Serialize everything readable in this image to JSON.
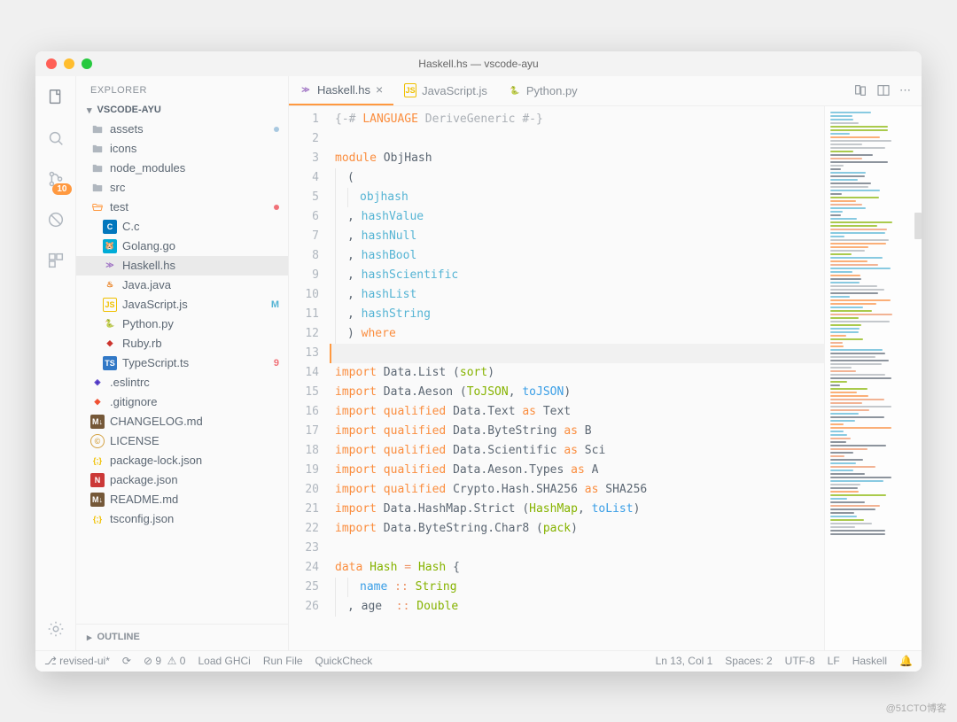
{
  "window": {
    "title": "Haskell.hs — vscode-ayu"
  },
  "sidebar": {
    "title": "EXPLORER",
    "folder": "VSCODE-AYU",
    "outline": "OUTLINE"
  },
  "activitybar": {
    "scm_badge": "10"
  },
  "tree": [
    {
      "depth": 0,
      "type": "folder",
      "label": "assets",
      "badge": "bluedot"
    },
    {
      "depth": 0,
      "type": "folder",
      "label": "icons"
    },
    {
      "depth": 0,
      "type": "folder",
      "label": "node_modules"
    },
    {
      "depth": 0,
      "type": "folder",
      "label": "src"
    },
    {
      "depth": 0,
      "type": "folder-open",
      "label": "test",
      "badge": "reddot"
    },
    {
      "depth": 1,
      "type": "c",
      "label": "C.c"
    },
    {
      "depth": 1,
      "type": "go",
      "label": "Golang.go"
    },
    {
      "depth": 1,
      "type": "hs",
      "label": "Haskell.hs",
      "selected": true
    },
    {
      "depth": 1,
      "type": "java",
      "label": "Java.java"
    },
    {
      "depth": 1,
      "type": "js",
      "label": "JavaScript.js",
      "badge": "M"
    },
    {
      "depth": 1,
      "type": "py",
      "label": "Python.py"
    },
    {
      "depth": 1,
      "type": "rb",
      "label": "Ruby.rb"
    },
    {
      "depth": 1,
      "type": "ts",
      "label": "TypeScript.ts",
      "badge": "9"
    },
    {
      "depth": 0,
      "type": "eslint",
      "label": ".eslintrc"
    },
    {
      "depth": 0,
      "type": "git",
      "label": ".gitignore"
    },
    {
      "depth": 0,
      "type": "md",
      "label": "CHANGELOG.md"
    },
    {
      "depth": 0,
      "type": "lic",
      "label": "LICENSE"
    },
    {
      "depth": 0,
      "type": "json",
      "label": "package-lock.json"
    },
    {
      "depth": 0,
      "type": "npm",
      "label": "package.json"
    },
    {
      "depth": 0,
      "type": "md",
      "label": "README.md"
    },
    {
      "depth": 0,
      "type": "json",
      "label": "tsconfig.json"
    }
  ],
  "tabs": [
    {
      "icon": "hs",
      "label": "Haskell.hs",
      "active": true,
      "dirty": true
    },
    {
      "icon": "js",
      "label": "JavaScript.js"
    },
    {
      "icon": "py",
      "label": "Python.py"
    }
  ],
  "code": [
    {
      "n": 1,
      "tokens": [
        [
          "comment",
          "{-# "
        ],
        [
          "kw",
          "LANGUAGE"
        ],
        [
          "comment",
          " DeriveGeneric #-}"
        ]
      ]
    },
    {
      "n": 2,
      "tokens": []
    },
    {
      "n": 3,
      "tokens": [
        [
          "kw",
          "module"
        ],
        [
          "punc",
          " ObjHash"
        ]
      ]
    },
    {
      "n": 4,
      "ind": 1,
      "tokens": [
        [
          "punc",
          "("
        ]
      ]
    },
    {
      "n": 5,
      "ind": 2,
      "tokens": [
        [
          "id",
          "objhash"
        ]
      ]
    },
    {
      "n": 6,
      "ind": 1,
      "tokens": [
        [
          "punc",
          ", "
        ],
        [
          "id",
          "hashValue"
        ]
      ]
    },
    {
      "n": 7,
      "ind": 1,
      "tokens": [
        [
          "punc",
          ", "
        ],
        [
          "id",
          "hashNull"
        ]
      ]
    },
    {
      "n": 8,
      "ind": 1,
      "tokens": [
        [
          "punc",
          ", "
        ],
        [
          "id",
          "hashBool"
        ]
      ]
    },
    {
      "n": 9,
      "ind": 1,
      "tokens": [
        [
          "punc",
          ", "
        ],
        [
          "id",
          "hashScientific"
        ]
      ]
    },
    {
      "n": 10,
      "ind": 1,
      "tokens": [
        [
          "punc",
          ", "
        ],
        [
          "id",
          "hashList"
        ]
      ]
    },
    {
      "n": 11,
      "ind": 1,
      "tokens": [
        [
          "punc",
          ", "
        ],
        [
          "id",
          "hashString"
        ]
      ]
    },
    {
      "n": 12,
      "ind": 1,
      "tokens": [
        [
          "punc",
          ") "
        ],
        [
          "kw",
          "where"
        ]
      ]
    },
    {
      "n": 13,
      "cur": true,
      "tokens": []
    },
    {
      "n": 14,
      "tokens": [
        [
          "kw",
          "import"
        ],
        [
          "punc",
          " Data.List ("
        ],
        [
          "type",
          "sort"
        ],
        [
          "punc",
          ")"
        ]
      ]
    },
    {
      "n": 15,
      "tokens": [
        [
          "kw",
          "import"
        ],
        [
          "punc",
          " Data.Aeson ("
        ],
        [
          "type",
          "ToJSON"
        ],
        [
          "punc",
          ", "
        ],
        [
          "id2",
          "toJSON"
        ],
        [
          "punc",
          ")"
        ]
      ]
    },
    {
      "n": 16,
      "tokens": [
        [
          "kw",
          "import"
        ],
        [
          "punc",
          " "
        ],
        [
          "kw",
          "qualified"
        ],
        [
          "punc",
          " Data.Text "
        ],
        [
          "kw",
          "as"
        ],
        [
          "punc",
          " Text"
        ]
      ]
    },
    {
      "n": 17,
      "tokens": [
        [
          "kw",
          "import"
        ],
        [
          "punc",
          " "
        ],
        [
          "kw",
          "qualified"
        ],
        [
          "punc",
          " Data.ByteString "
        ],
        [
          "kw",
          "as"
        ],
        [
          "punc",
          " B"
        ]
      ]
    },
    {
      "n": 18,
      "tokens": [
        [
          "kw",
          "import"
        ],
        [
          "punc",
          " "
        ],
        [
          "kw",
          "qualified"
        ],
        [
          "punc",
          " Data.Scientific "
        ],
        [
          "kw",
          "as"
        ],
        [
          "punc",
          " Sci"
        ]
      ]
    },
    {
      "n": 19,
      "tokens": [
        [
          "kw",
          "import"
        ],
        [
          "punc",
          " "
        ],
        [
          "kw",
          "qualified"
        ],
        [
          "punc",
          " Data.Aeson.Types "
        ],
        [
          "kw",
          "as"
        ],
        [
          "punc",
          " A"
        ]
      ]
    },
    {
      "n": 20,
      "tokens": [
        [
          "kw",
          "import"
        ],
        [
          "punc",
          " "
        ],
        [
          "kw",
          "qualified"
        ],
        [
          "punc",
          " Crypto.Hash.SHA256 "
        ],
        [
          "kw",
          "as"
        ],
        [
          "punc",
          " SHA256"
        ]
      ]
    },
    {
      "n": 21,
      "tokens": [
        [
          "kw",
          "import"
        ],
        [
          "punc",
          " Data.HashMap.Strict ("
        ],
        [
          "type",
          "HashMap"
        ],
        [
          "punc",
          ", "
        ],
        [
          "id2",
          "toList"
        ],
        [
          "punc",
          ")"
        ]
      ]
    },
    {
      "n": 22,
      "tokens": [
        [
          "kw",
          "import"
        ],
        [
          "punc",
          " Data.ByteString.Char8 ("
        ],
        [
          "type",
          "pack"
        ],
        [
          "punc",
          ")"
        ]
      ]
    },
    {
      "n": 23,
      "tokens": []
    },
    {
      "n": 24,
      "tokens": [
        [
          "kw",
          "data"
        ],
        [
          "punc",
          " "
        ],
        [
          "type",
          "Hash"
        ],
        [
          "punc",
          " "
        ],
        [
          "op",
          "="
        ],
        [
          "punc",
          " "
        ],
        [
          "type",
          "Hash"
        ],
        [
          "punc",
          " {"
        ]
      ]
    },
    {
      "n": 25,
      "ind": 2,
      "tokens": [
        [
          "id2",
          "name"
        ],
        [
          "punc",
          " "
        ],
        [
          "op",
          "::"
        ],
        [
          "punc",
          " "
        ],
        [
          "type",
          "String"
        ]
      ]
    },
    {
      "n": 26,
      "ind": 1,
      "tokens": [
        [
          "punc",
          ", age  "
        ],
        [
          "op",
          "::"
        ],
        [
          "punc",
          " "
        ],
        [
          "type",
          "Double"
        ]
      ]
    }
  ],
  "status": {
    "branch": "revised-ui*",
    "sync": "",
    "errors": "9",
    "warnings": "0",
    "loadghci": "Load GHCi",
    "runfile": "Run File",
    "quickcheck": "QuickCheck",
    "pos": "Ln 13, Col 1",
    "spaces": "Spaces: 2",
    "enc": "UTF-8",
    "eol": "LF",
    "lang": "Haskell"
  },
  "watermark": "@51CTO博客"
}
